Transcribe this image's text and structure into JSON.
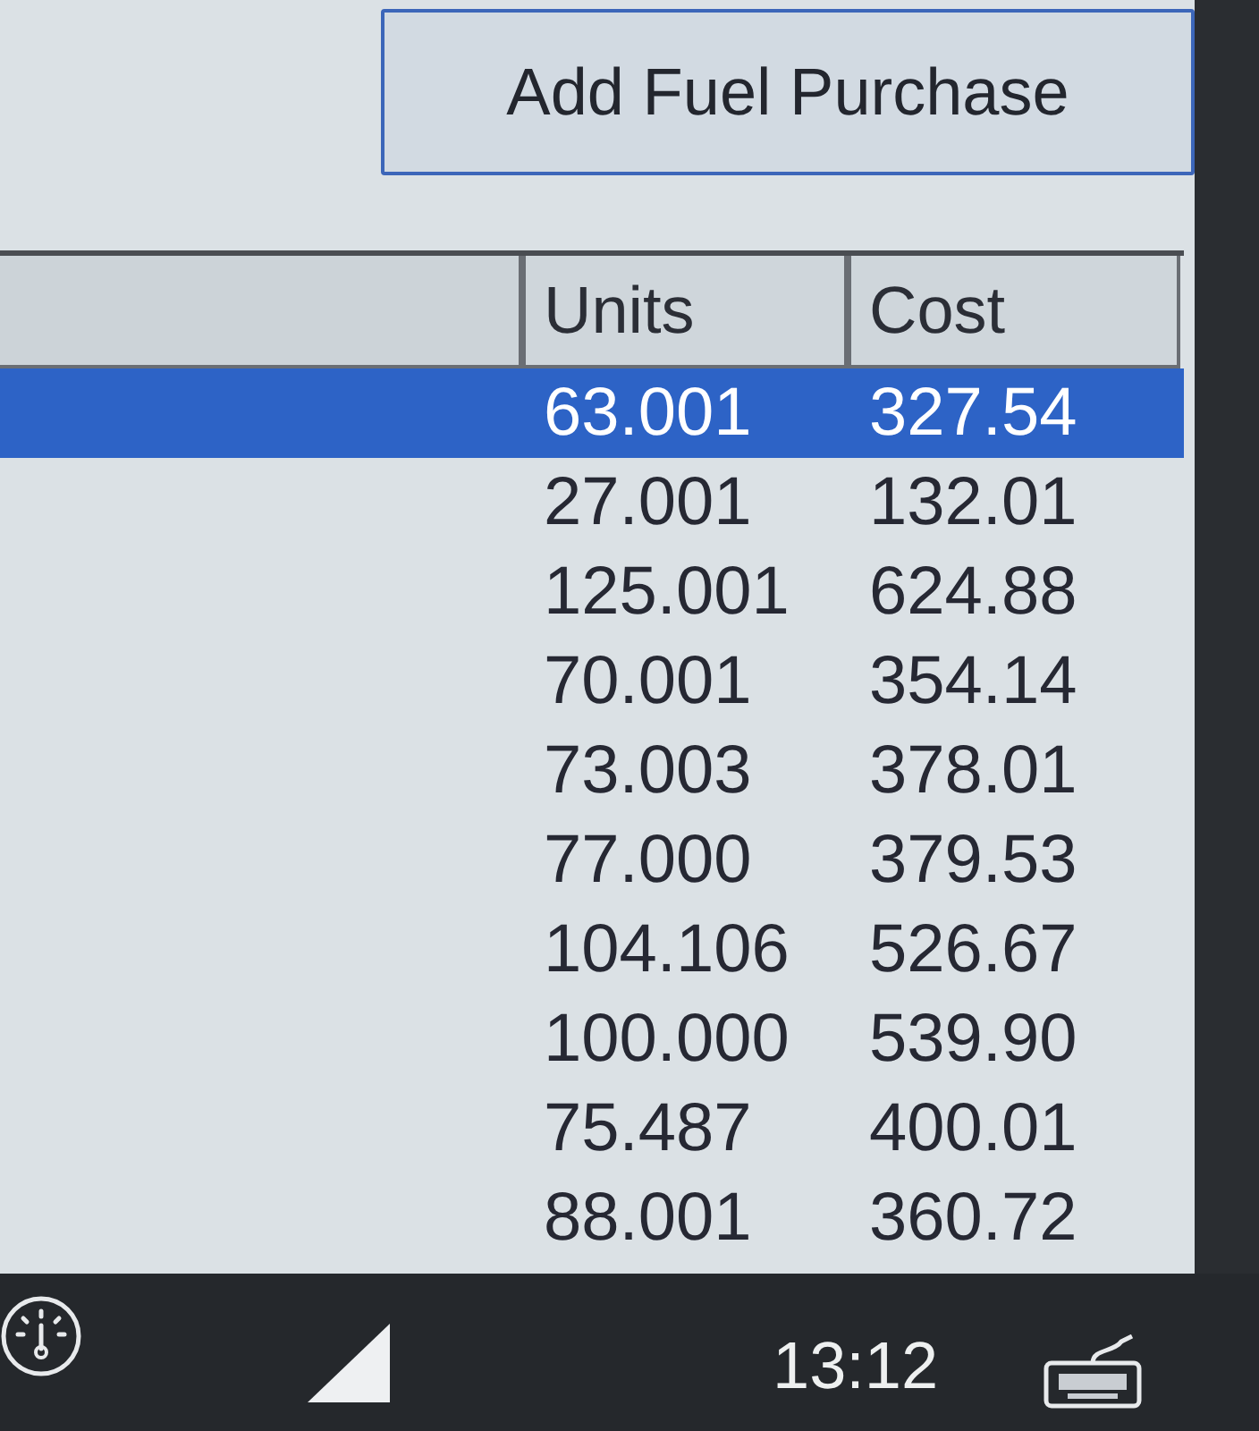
{
  "toolbar": {
    "button": "Add Fuel Purchase"
  },
  "table": {
    "columns": [
      "Units",
      "Cost"
    ],
    "rows": [
      {
        "units": "63.001",
        "cost": "327.54",
        "selected": true
      },
      {
        "units": "27.001",
        "cost": "132.01",
        "selected": false
      },
      {
        "units": "125.001",
        "cost": "624.88",
        "selected": false
      },
      {
        "units": "70.001",
        "cost": "354.14",
        "selected": false
      },
      {
        "units": "73.003",
        "cost": "378.01",
        "selected": false
      },
      {
        "units": "77.000",
        "cost": "379.53",
        "selected": false
      },
      {
        "units": "104.106",
        "cost": "526.67",
        "selected": false
      },
      {
        "units": "100.000",
        "cost": "539.90",
        "selected": false
      },
      {
        "units": "75.487",
        "cost": "400.01",
        "selected": false
      },
      {
        "units": "88.001",
        "cost": "360.72",
        "selected": false
      }
    ]
  },
  "taskbar": {
    "time": "13:12"
  }
}
